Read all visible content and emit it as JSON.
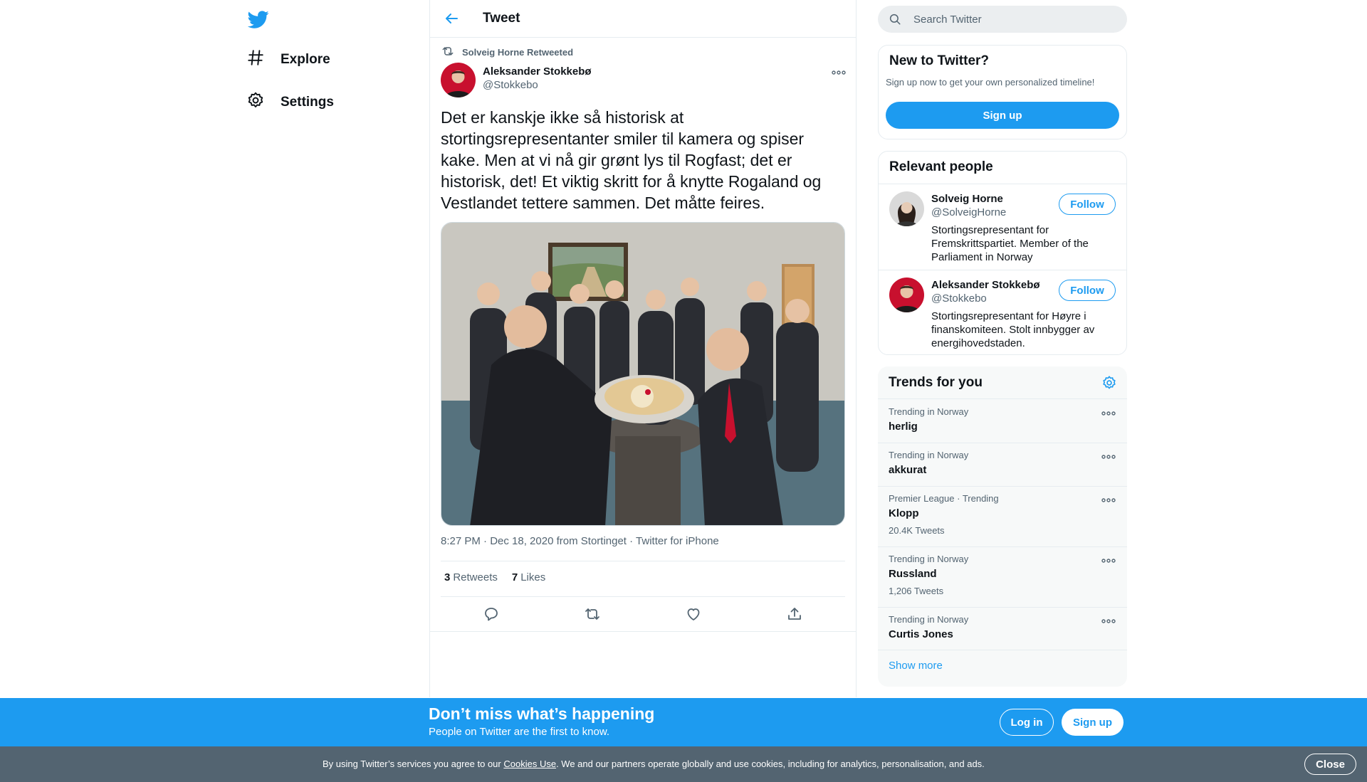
{
  "nav": {
    "logo_icon": "twitter-bird-icon",
    "items": [
      {
        "label": "Explore",
        "icon": "hashtag-icon"
      },
      {
        "label": "Settings",
        "icon": "gear-icon"
      }
    ]
  },
  "main": {
    "title": "Tweet",
    "retweeted_by": "Solveig Horne Retweeted",
    "author": {
      "name": "Aleksander Stokkebø",
      "handle": "@Stokkebo"
    },
    "text": "Det er kanskje ikke så historisk at stortingsrepresentanter smiler til kamera og spiser kake. Men at vi nå gir grønt lys til Rogfast; det er historisk, det! Et viktig skritt for å knytte Rogaland og Vestlandet tettere sammen. Det måtte feires.",
    "meta": {
      "time": "8:27 PM · Dec 18, 2020 from ",
      "place": "Stortinget",
      "sep": " · ",
      "source": "Twitter for iPhone"
    },
    "stats": {
      "retweets_count": "3",
      "retweets_label": "Retweets",
      "likes_count": "7",
      "likes_label": "Likes"
    }
  },
  "sidebar": {
    "search_placeholder": "Search Twitter",
    "signup_card": {
      "title": "New to Twitter?",
      "subtitle": "Sign up now to get your own personalized timeline!",
      "button": "Sign up"
    },
    "people": {
      "title": "Relevant people",
      "items": [
        {
          "name": "Solveig Horne",
          "handle": "@SolveigHorne",
          "bio": "Stortingsrepresentant for Fremskrittspartiet. Member of the Parliament in Norway",
          "button": "Follow"
        },
        {
          "name": "Aleksander Stokkebø",
          "handle": "@Stokkebo",
          "bio": "Stortingsrepresentant for Høyre i finanskomiteen. Stolt innbygger av energihovedstaden.",
          "button": "Follow"
        }
      ]
    },
    "trends": {
      "title": "Trends for you",
      "items": [
        {
          "context": "Trending in Norway",
          "name": "herlig",
          "count": ""
        },
        {
          "context": "Trending in Norway",
          "name": "akkurat",
          "count": ""
        },
        {
          "context": "Premier League · Trending",
          "name": "Klopp",
          "count": "20.4K Tweets"
        },
        {
          "context": "Trending in Norway",
          "name": "Russland",
          "count": "1,206 Tweets"
        },
        {
          "context": "Trending in Norway",
          "name": "Curtis Jones",
          "count": ""
        }
      ],
      "show_more": "Show more"
    }
  },
  "banner": {
    "title": "Don’t miss what’s happening",
    "subtitle": "People on Twitter are the first to know.",
    "login": "Log in",
    "signup": "Sign up"
  },
  "cookie": {
    "text_before": "By using Twitter’s services you agree to our ",
    "link": "Cookies Use",
    "text_after": ". We and our partners operate globally and use cookies, including for analytics, personalisation, and ads.",
    "close": "Close"
  },
  "colors": {
    "accent": "#1d9bf0",
    "text": "#0f1419",
    "muted": "#536471",
    "border": "#e6ecf0"
  }
}
